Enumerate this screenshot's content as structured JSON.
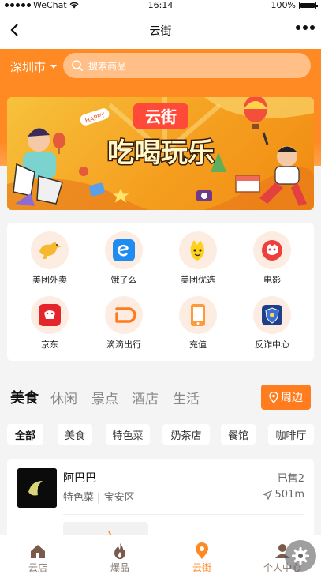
{
  "status_bar": {
    "carrier": "WeChat",
    "time": "16:14",
    "battery": "100%"
  },
  "nav": {
    "title": "云街"
  },
  "header": {
    "city": "深圳市",
    "search_placeholder": "搜索商品"
  },
  "banner": {
    "brand": "云街",
    "slogan": "吃喝玩乐",
    "tag": "HAPPY"
  },
  "services": [
    {
      "label": "美团外卖",
      "icon": "kangaroo-icon"
    },
    {
      "label": "饿了么",
      "icon": "eleme-icon"
    },
    {
      "label": "美团优选",
      "icon": "meituan-youxuan-icon"
    },
    {
      "label": "电影",
      "icon": "movie-icon"
    },
    {
      "label": "京东",
      "icon": "jd-icon"
    },
    {
      "label": "滴滴出行",
      "icon": "didi-icon"
    },
    {
      "label": "充值",
      "icon": "phone-recharge-icon"
    },
    {
      "label": "反诈中心",
      "icon": "anti-fraud-shield-icon"
    }
  ],
  "category_tabs": [
    "美食",
    "休闲",
    "景点",
    "酒店",
    "生活"
  ],
  "nearby_label": "周边",
  "chips": [
    "全部",
    "美食",
    "特色菜",
    "奶茶店",
    "餐馆",
    "咖啡厅"
  ],
  "store": {
    "name": "阿巴巴",
    "category": "特色菜",
    "district": "宝安区",
    "sold": "已售2",
    "distance": "501m"
  },
  "tab_bar": [
    {
      "label": "云店",
      "icon": "house-icon"
    },
    {
      "label": "爆品",
      "icon": "flame-icon"
    },
    {
      "label": "云街",
      "icon": "location-pin-icon"
    },
    {
      "label": "个人中心",
      "icon": "user-icon"
    }
  ],
  "colors": {
    "accent": "#ff8a24",
    "button": "#ff7d1f"
  }
}
